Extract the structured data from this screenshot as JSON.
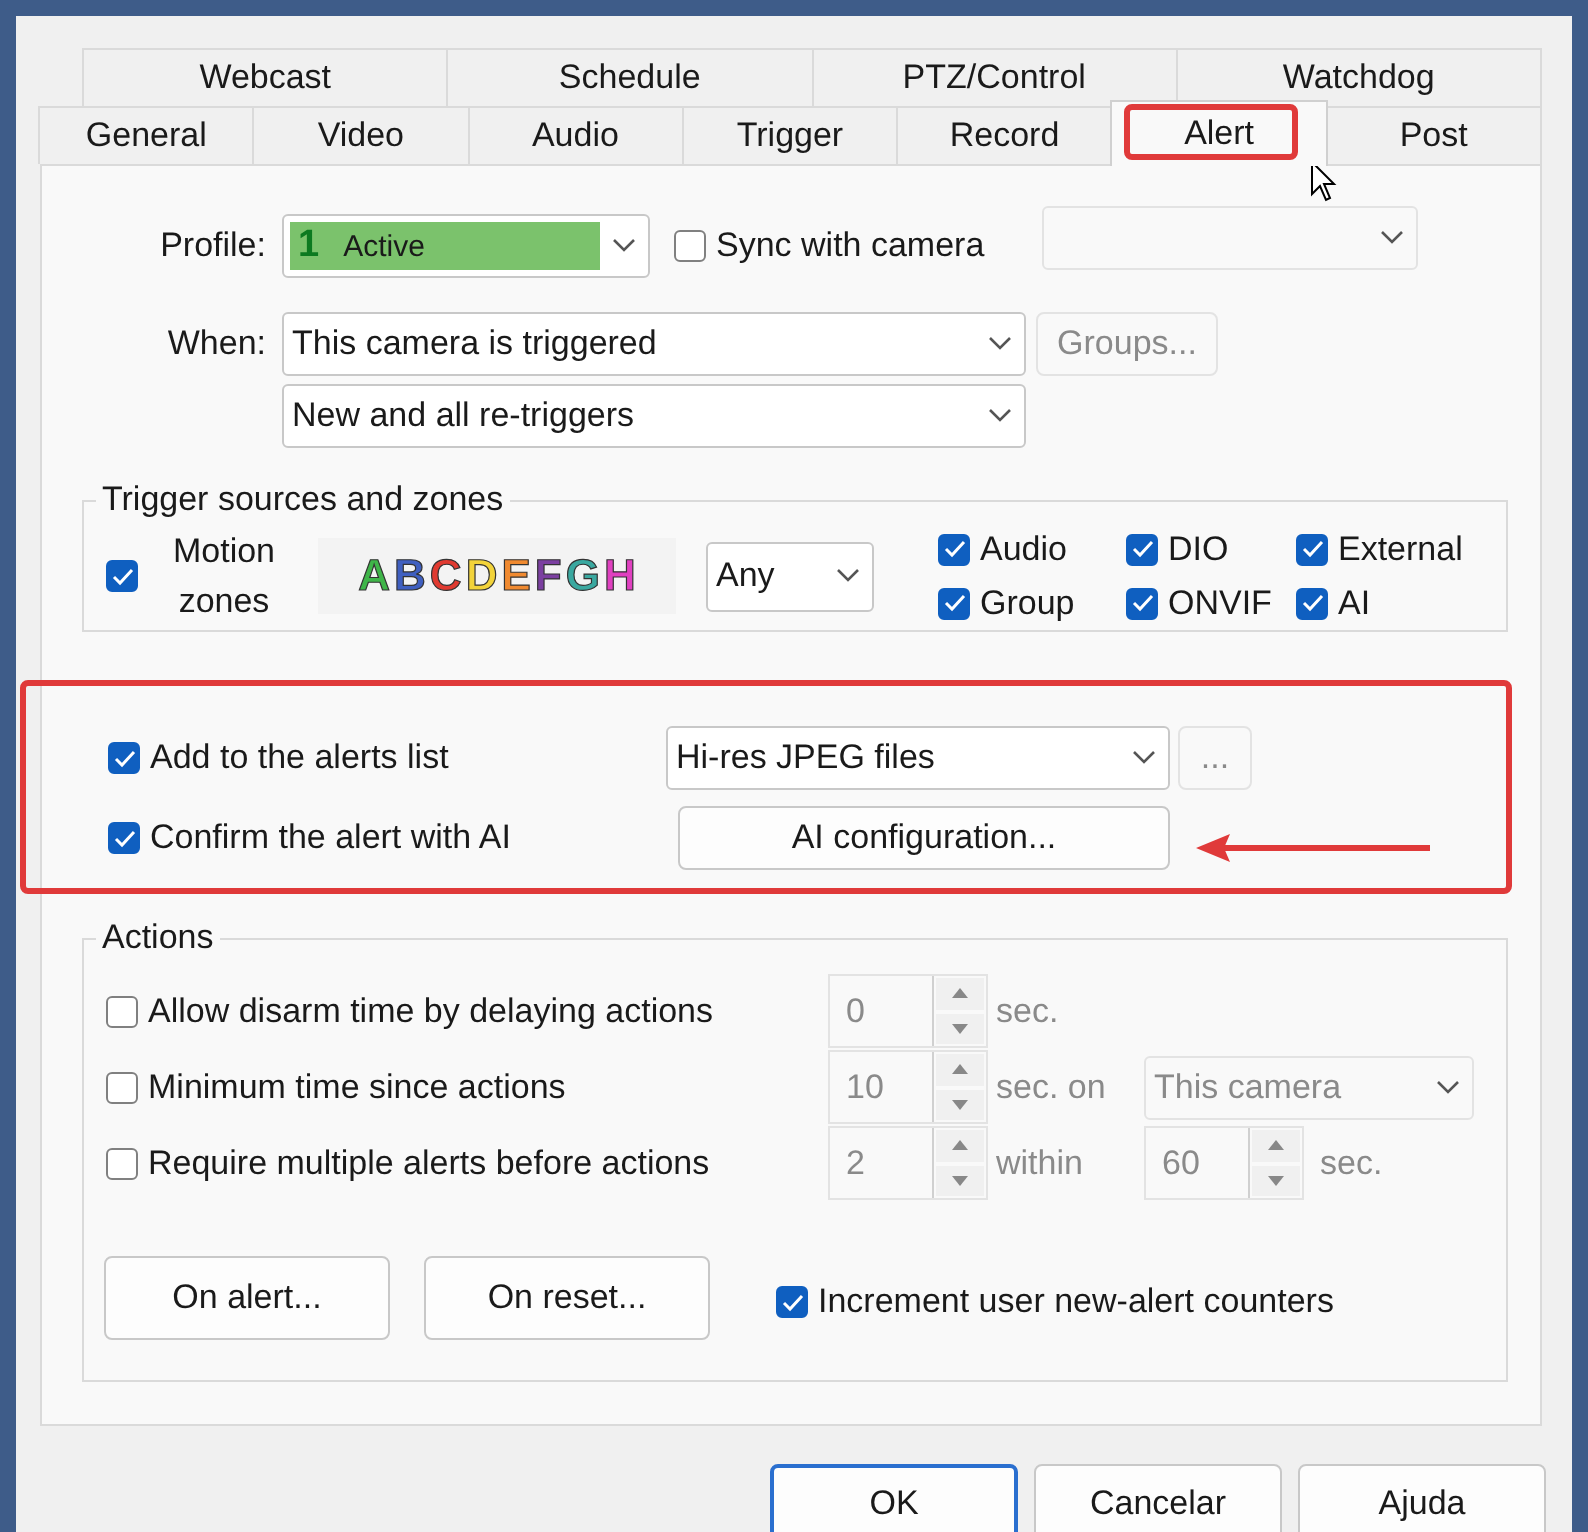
{
  "tabs": [
    [
      {
        "label": "Webcast",
        "selected": false
      },
      {
        "label": "Schedule",
        "selected": false
      },
      {
        "label": "PTZ/Control",
        "selected": false
      },
      {
        "label": "Watchdog",
        "selected": false
      }
    ],
    [
      {
        "label": "General",
        "selected": false
      },
      {
        "label": "Video",
        "selected": false
      },
      {
        "label": "Audio",
        "selected": false
      },
      {
        "label": "Trigger",
        "selected": false
      },
      {
        "label": "Record",
        "selected": false
      },
      {
        "label": "Alert",
        "selected": true,
        "highlighted": true
      },
      {
        "label": "Post",
        "selected": false
      }
    ]
  ],
  "profile": {
    "label": "Profile:",
    "number": "1",
    "value": "Active"
  },
  "sync": {
    "label": "Sync with camera",
    "checked": false,
    "dropdown_disabled": true
  },
  "when": {
    "label": "When:",
    "trigger": "This camera is triggered",
    "retrigger": "New and all re-triggers",
    "groups_button": {
      "label": "Groups...",
      "disabled": true
    }
  },
  "trigger_sources": {
    "title": "Trigger sources and zones",
    "motion": {
      "label": "Motion zones",
      "checked": true
    },
    "zones": [
      {
        "label": "A",
        "color": "#3fb549"
      },
      {
        "label": "B",
        "color": "#3f5fc0"
      },
      {
        "label": "C",
        "color": "#e03a30"
      },
      {
        "label": "D",
        "color": "#f2d33a"
      },
      {
        "label": "E",
        "color": "#f08a30"
      },
      {
        "label": "F",
        "color": "#7b3fa0"
      },
      {
        "label": "G",
        "color": "#3aa8a0"
      },
      {
        "label": "H",
        "color": "#e040c0"
      }
    ],
    "zone_mode": "Any",
    "sources": [
      {
        "label": "Audio",
        "checked": true
      },
      {
        "label": "DIO",
        "checked": true
      },
      {
        "label": "External",
        "checked": true
      },
      {
        "label": "Group",
        "checked": true
      },
      {
        "label": "ONVIF",
        "checked": true
      },
      {
        "label": "AI",
        "checked": true
      }
    ]
  },
  "alerts": {
    "highlighted": true,
    "add_to_list": {
      "label": "Add to the alerts list",
      "checked": true,
      "format": "Hi-res JPEG files",
      "more_button": "..."
    },
    "confirm_ai": {
      "label": "Confirm the alert with AI",
      "checked": true,
      "button": "AI configuration...",
      "arrow": true
    }
  },
  "actions": {
    "title": "Actions",
    "rows": [
      {
        "kind": "delay",
        "label": "Allow disarm time by delaying actions",
        "checked": false,
        "value": "0",
        "unit": "sec.",
        "disabled": true
      },
      {
        "kind": "scope",
        "label": "Minimum time since actions",
        "checked": false,
        "value": "10",
        "unit": "sec. on",
        "scope": "This camera",
        "disabled": true
      },
      {
        "kind": "count",
        "label": "Require multiple alerts before actions",
        "checked": false,
        "value": "2",
        "unit": "within",
        "value2": "60",
        "unit2": "sec.",
        "disabled": true
      }
    ],
    "buttons": [
      "On alert...",
      "On reset..."
    ],
    "increment": {
      "label": "Increment user new-alert counters",
      "checked": true
    }
  },
  "footer_buttons": [
    {
      "label": "OK",
      "selected": true
    },
    {
      "label": "Cancelar",
      "selected": false
    },
    {
      "label": "Ajuda",
      "selected": false
    }
  ]
}
